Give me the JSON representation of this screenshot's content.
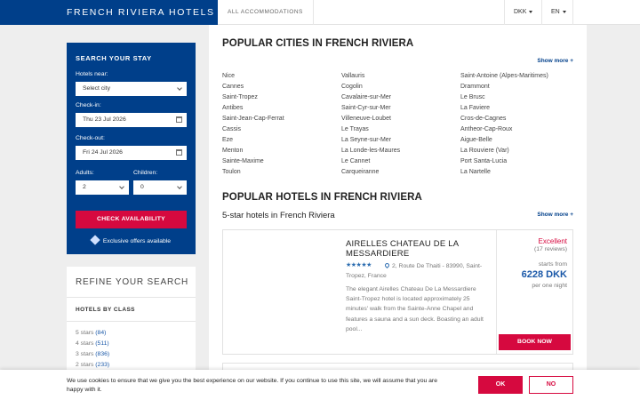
{
  "header": {
    "logo": "FRENCH RIVIERA HOTELS",
    "nav_accommodations": "ALL ACCOMMODATIONS",
    "currency": "DKK",
    "language": "EN"
  },
  "search": {
    "title": "SEARCH YOUR STAY",
    "hotels_near_label": "Hotels near:",
    "hotels_near_value": "Select city",
    "checkin_label": "Check-in:",
    "checkin_value": "Thu 23 Jul 2026",
    "checkout_label": "Check-out:",
    "checkout_value": "Fri 24 Jul 2026",
    "adults_label": "Adults:",
    "adults_value": "2",
    "children_label": "Children:",
    "children_value": "0",
    "button": "CHECK AVAILABILITY",
    "offers": "Exclusive offers available"
  },
  "refine": {
    "title": "REFINE YOUR SEARCH",
    "class_title": "HOTELS BY CLASS",
    "items": [
      {
        "label": "5 stars",
        "count": "(84)"
      },
      {
        "label": "4 stars",
        "count": "(511)"
      },
      {
        "label": "3 stars",
        "count": "(836)"
      },
      {
        "label": "2 stars",
        "count": "(233)"
      }
    ]
  },
  "cities": {
    "title": "POPULAR CITIES IN FRENCH RIVIERA",
    "show_more": "Show more +",
    "col1": [
      "Nice",
      "Cannes",
      "Saint-Tropez",
      "Antibes",
      "Saint-Jean-Cap-Ferrat",
      "Cassis",
      "Eze",
      "Menton",
      "Sainte-Maxime",
      "Toulon"
    ],
    "col2": [
      "Vallauris",
      "Cogolin",
      "Cavalaire-sur-Mer",
      "Saint-Cyr-sur-Mer",
      "Villeneuve-Loubet",
      "Le Trayas",
      "La Seyne-sur-Mer",
      "La Londe-les-Maures",
      "Le Cannet",
      "Carqueiranne"
    ],
    "col3": [
      "Saint-Antoine (Alpes-Maritimes)",
      "Drammont",
      "Le Brusc",
      "La Faviere",
      "Cros-de-Cagnes",
      "Antheor-Cap-Roux",
      "Aigue-Belle",
      "La Rouviere (Var)",
      "Port Santa-Lucia",
      "La Nartelle"
    ]
  },
  "hotels": {
    "title": "POPULAR HOTELS IN FRENCH RIVIERA",
    "subtitle": "5-star hotels in French Riviera",
    "show_more": "Show more +",
    "card": {
      "name": "AIRELLES CHATEAU DE LA MESSARDIERE",
      "stars": "★★★★★",
      "address": "2, Route De Thaiti - 83990, Saint-Tropez, France",
      "description": "The elegant Airelles Chateau De La Messardiere Saint-Tropez hotel is located approximately 25 minutes' walk from the Sainte-Anne Chapel and features a sauna and a sun deck. Boasting an adult pool...",
      "rating": "Excellent",
      "reviews": "(17 reviews)",
      "starts_from": "starts from",
      "price": "6228 DKK",
      "per_night": "per one night",
      "button": "BOOK NOW"
    }
  },
  "cookie": {
    "text": "We use cookies to ensure that we give you the best experience on our website. If you continue to use this site, we will assume that you are happy with it.",
    "ok": "OK",
    "no": "NO"
  },
  "colors": {
    "brand_blue": "#003f8a",
    "accent_red": "#d6093f",
    "link_blue": "#1a58a8"
  }
}
